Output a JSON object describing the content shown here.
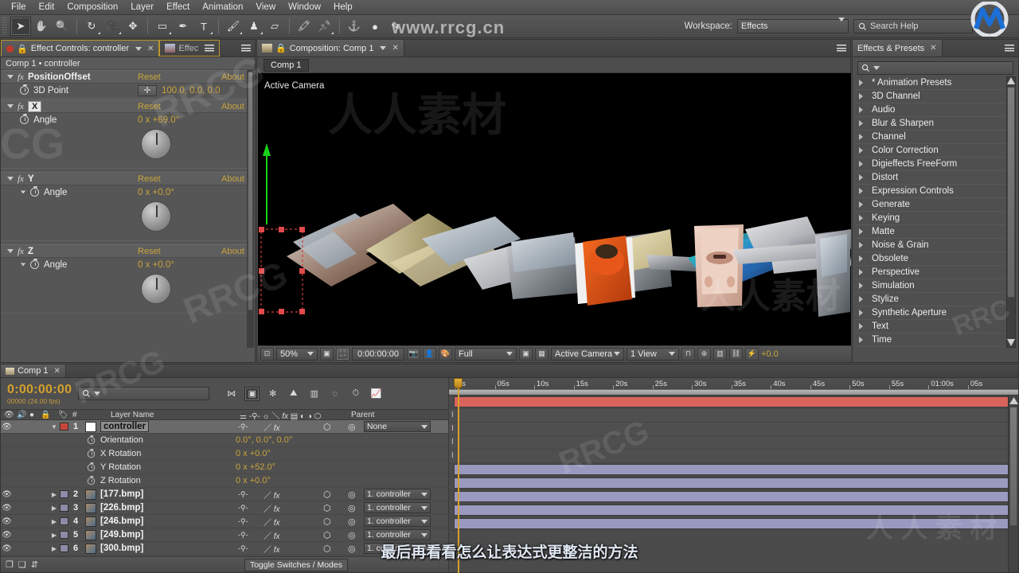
{
  "menubar": {
    "items": [
      "File",
      "Edit",
      "Composition",
      "Layer",
      "Effect",
      "Animation",
      "View",
      "Window",
      "Help"
    ]
  },
  "toolbar": {
    "tools": [
      {
        "name": "selection-tool",
        "glyph": "➤",
        "selected": true
      },
      {
        "name": "hand-tool",
        "glyph": "✋",
        "selected": false
      },
      {
        "name": "zoom-tool",
        "glyph": "🔍",
        "selected": false
      },
      {
        "name": "rotation-tool",
        "glyph": "↻",
        "selected": false
      },
      {
        "name": "camera-tool",
        "glyph": "🎥",
        "selected": false
      },
      {
        "name": "pan-behind-tool",
        "glyph": "✥",
        "selected": false
      },
      {
        "name": "shape-tool",
        "glyph": "▭",
        "selected": false
      },
      {
        "name": "pen-tool",
        "glyph": "✒",
        "selected": false
      },
      {
        "name": "type-tool",
        "glyph": "T",
        "selected": false
      },
      {
        "name": "brush-tool",
        "glyph": "🖌",
        "selected": false
      },
      {
        "name": "clone-stamp-tool",
        "glyph": "♟",
        "selected": false
      },
      {
        "name": "eraser-tool",
        "glyph": "▱",
        "selected": false
      },
      {
        "name": "roto-brush-tool",
        "glyph": "🖍",
        "selected": false
      },
      {
        "name": "puppet-pin-tool",
        "glyph": "📌",
        "selected": false
      },
      {
        "name": "anchor-point-tool",
        "glyph": "⚓",
        "selected": false
      },
      {
        "name": "mask-feather-tool",
        "glyph": "●",
        "selected": false
      },
      {
        "name": "motion-sketch-tool",
        "glyph": "✎",
        "selected": false
      }
    ],
    "workspace_label": "Workspace:",
    "workspace_value": "Effects",
    "search_help_placeholder": "Search Help"
  },
  "effect_controls": {
    "tab_title": "Effect Controls: controller",
    "inactive_tab_title": "Effec",
    "header": "Comp 1 • controller",
    "reset_label": "Reset",
    "about_label": "About",
    "groups": [
      {
        "name": "PositionOffset",
        "type": "fx",
        "props": [
          {
            "label": "3D Point",
            "value": "100.0, 0.0, 0.0",
            "has_point_box": true
          }
        ]
      },
      {
        "name": "X",
        "type": "badge",
        "props": [
          {
            "label": "Angle",
            "value": "0 x +69.0°",
            "has_point_box": false
          }
        ]
      },
      {
        "name": "Y",
        "type": "fx",
        "props": [
          {
            "label": "Angle",
            "value": "0 x +0.0°",
            "has_point_box": false
          }
        ]
      },
      {
        "name": "Z",
        "type": "fx",
        "props": [
          {
            "label": "Angle",
            "value": "0 x +0.0°",
            "has_point_box": false
          }
        ]
      }
    ]
  },
  "composition": {
    "tab_title": "Composition: Comp 1",
    "breadcrumb": "Comp 1",
    "view_label": "Active Camera",
    "bottom_bar": {
      "magnification": "50%",
      "timecode": "0:00:00:00",
      "resolution": "Full",
      "camera_view": "Active Camera",
      "view_layout": "1 View",
      "exposure": "+0.0"
    }
  },
  "effects_presets": {
    "tab_title": "Effects & Presets",
    "search_placeholder": "",
    "categories": [
      "* Animation Presets",
      "3D Channel",
      "Audio",
      "Blur & Sharpen",
      "Channel",
      "Color Correction",
      "Digieffects FreeForm",
      "Distort",
      "Expression Controls",
      "Generate",
      "Keying",
      "Matte",
      "Noise & Grain",
      "Obsolete",
      "Perspective",
      "Simulation",
      "Stylize",
      "Synthetic Aperture",
      "Text",
      "Time"
    ]
  },
  "timeline": {
    "tab_title": "Comp 1",
    "current_time": "0:00:00:00",
    "frame_info": "00000 (24.00 fps)",
    "search_placeholder": "",
    "columns": {
      "layer_name": "Layer Name",
      "parent": "Parent"
    },
    "toggle_switches_label": "Toggle Switches / Modes",
    "ruler_ticks": [
      "0s",
      "05s",
      "10s",
      "15s",
      "20s",
      "25s",
      "30s",
      "35s",
      "40s",
      "45s",
      "50s",
      "55s",
      "01:00s",
      "05s"
    ],
    "layers": [
      {
        "index": "1",
        "name": "controller",
        "parent": "None",
        "selected": true,
        "color": "#c9463c",
        "bar_color": "#d9645c",
        "properties": [
          {
            "label": "Orientation",
            "value": "0.0°, 0.0°, 0.0°"
          },
          {
            "label": "X Rotation",
            "value": "0 x +0.0°"
          },
          {
            "label": "Y Rotation",
            "value": "0 x +52.0°"
          },
          {
            "label": "Z Rotation",
            "value": "0 x +0.0°"
          }
        ]
      },
      {
        "index": "2",
        "name": "[177.bmp]",
        "parent": "1. controller",
        "selected": false,
        "color": "#8c8ca8",
        "bar_color": "#9a9ac0",
        "properties": []
      },
      {
        "index": "3",
        "name": "[226.bmp]",
        "parent": "1. controller",
        "selected": false,
        "color": "#8c8ca8",
        "bar_color": "#9a9ac0",
        "properties": []
      },
      {
        "index": "4",
        "name": "[246.bmp]",
        "parent": "1. controller",
        "selected": false,
        "color": "#8c8ca8",
        "bar_color": "#9a9ac0",
        "properties": []
      },
      {
        "index": "5",
        "name": "[249.bmp]",
        "parent": "1. controller",
        "selected": false,
        "color": "#8c8ca8",
        "bar_color": "#9a9ac0",
        "properties": []
      },
      {
        "index": "6",
        "name": "[300.bmp]",
        "parent": "1. controller",
        "selected": false,
        "color": "#8c8ca8",
        "bar_color": "#9a9ac0",
        "properties": []
      }
    ]
  },
  "subtitle": "最后再看看怎么让表达式更整洁的方法",
  "watermarks": {
    "top": "www.rrcg.cn",
    "marks": [
      "人人素材",
      "RRCG",
      "CG",
      "RRCG",
      "人人素材",
      "人 人 素 材",
      "RRC"
    ]
  },
  "colors": {
    "accent_orange": "#c8a43c",
    "selected_layer": "#c9463c",
    "panel_bg": "#525252",
    "viewer_bg": "#000000"
  }
}
